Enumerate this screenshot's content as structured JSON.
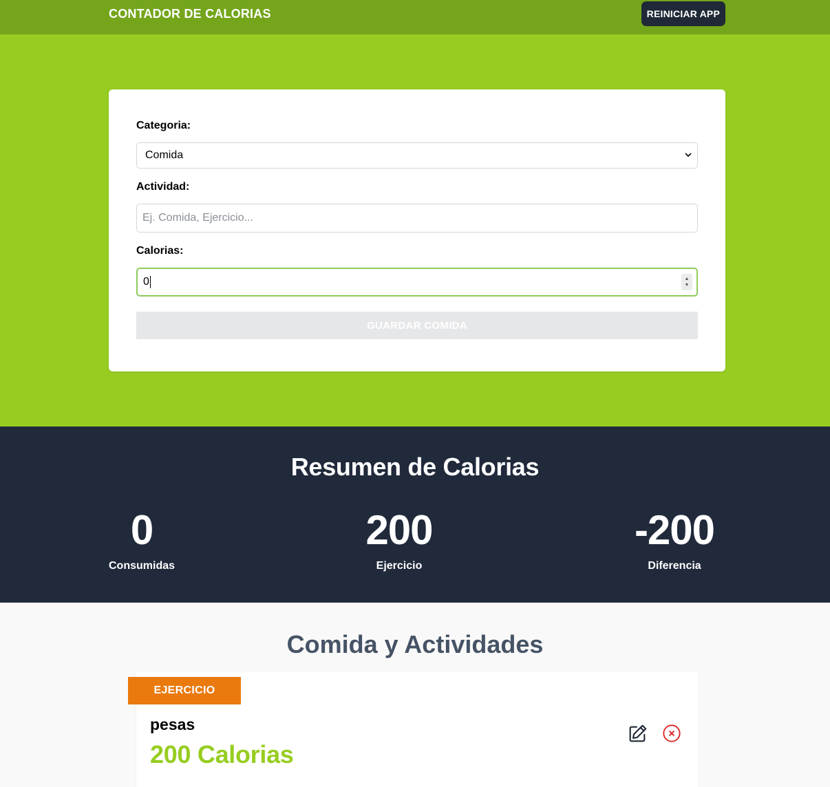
{
  "header": {
    "title": "CONTADOR DE CALORIAS",
    "reset_label": "REINICIAR APP"
  },
  "form": {
    "category_label": "Categoria:",
    "category_value": "Comida",
    "activity_label": "Actividad:",
    "activity_placeholder": "Ej. Comida, Ejercicio...",
    "calories_label": "Calorias:",
    "calories_value": "0",
    "save_label": "GUARDAR COMIDA"
  },
  "summary": {
    "title": "Resumen de Calorias",
    "stats": [
      {
        "value": "0",
        "label": "Consumidas"
      },
      {
        "value": "200",
        "label": "Ejercicio"
      },
      {
        "value": "-200",
        "label": "Diferencia"
      }
    ]
  },
  "activities": {
    "title": "Comida y Actividades",
    "items": [
      {
        "category": "EJERCICIO",
        "name": "pesas",
        "calories": "200 Calorias",
        "category_color": "#ea7a0e"
      }
    ]
  },
  "colors": {
    "header_bg": "#74a51b",
    "hero_bg": "#97cd21",
    "summary_bg": "#212a3b",
    "accent": "#97cd21",
    "delete": "#dc2626"
  },
  "icons": {
    "edit": "pencil-square-icon",
    "delete": "x-circle-icon",
    "select": "chevron-down-icon"
  }
}
